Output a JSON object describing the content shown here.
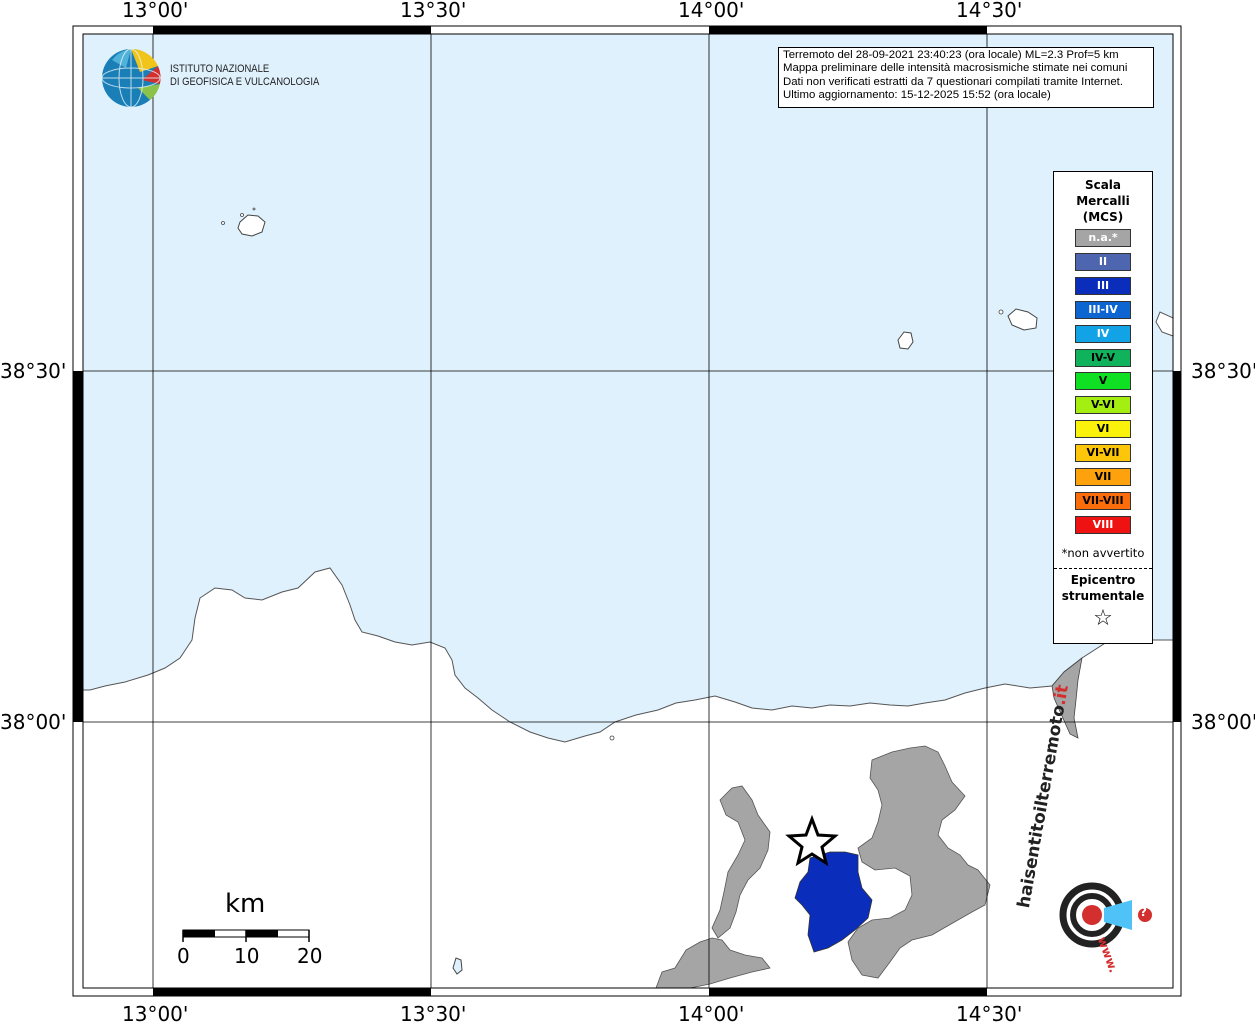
{
  "map": {
    "sea_color": "#dff1fd",
    "land_color": "#ffffff",
    "frame_color": "#000000"
  },
  "coordinates": {
    "lon_top": [
      "13°00'",
      "13°30'",
      "14°00'",
      "14°30'"
    ],
    "lon_bottom": [
      "13°00'",
      "13°30'",
      "14°00'",
      "14°30'"
    ],
    "lat_left": [
      "38°30'",
      "38°00'"
    ],
    "lat_right": [
      "38°30'",
      "38°00'"
    ]
  },
  "logo": {
    "line1": "ISTITUTO NAZIONALE",
    "line2": "DI GEOFISICA E VULCANOLOGIA"
  },
  "info": {
    "line1": "Terremoto del 28-09-2021 23:40:23 (ora locale) ML=2.3 Prof=5 km",
    "line2": "Mappa preliminare delle intensità macrosismiche stimate nei comuni",
    "line3": "Dati non verificati estratti da 7 questionari compilati tramite Internet.",
    "line4": "Ultimo aggiornamento: 15-12-2025 15:52 (ora locale)"
  },
  "legend": {
    "title1": "Scala",
    "title2": "Mercalli",
    "title3": "(MCS)",
    "items": [
      {
        "label": "n.a.*",
        "color": "#a5a5a5",
        "text_color": "#ffffff"
      },
      {
        "label": "II",
        "color": "#4e66b0",
        "text_color": "#ffffff"
      },
      {
        "label": "III",
        "color": "#0a2dbb",
        "text_color": "#ffffff"
      },
      {
        "label": "III-IV",
        "color": "#0d65d2",
        "text_color": "#ffffff"
      },
      {
        "label": "IV",
        "color": "#12a3e6",
        "text_color": "#ffffff"
      },
      {
        "label": "IV-V",
        "color": "#10b35c",
        "text_color": "#000000"
      },
      {
        "label": "V",
        "color": "#10e024",
        "text_color": "#000000"
      },
      {
        "label": "V-VI",
        "color": "#a5ee12",
        "text_color": "#000000"
      },
      {
        "label": "VI",
        "color": "#fbf20c",
        "text_color": "#000000"
      },
      {
        "label": "VI-VII",
        "color": "#fdc60b",
        "text_color": "#000000"
      },
      {
        "label": "VII",
        "color": "#fda10c",
        "text_color": "#000000"
      },
      {
        "label": "VII-VIII",
        "color": "#fb6d0b",
        "text_color": "#000000"
      },
      {
        "label": "VIII",
        "color": "#ef1212",
        "text_color": "#ffffff"
      }
    ],
    "note": "*non avvertito",
    "epicenter1": "Epicentro",
    "epicenter2": "strumentale",
    "star_symbol": "☆"
  },
  "scalebar": {
    "title": "km",
    "labels": [
      "0",
      "10",
      "20"
    ]
  },
  "intensity_areas": [
    {
      "name": "comune III",
      "intensity": "III",
      "color": "#0a2dbb"
    },
    {
      "name": "comuni n.a.",
      "intensity": "n.a.*",
      "color": "#a5a5a5"
    }
  ],
  "badge": {
    "text_main": "haisentitoilterremoto",
    "text_it": ".it",
    "text_www": "www.",
    "question": "?"
  }
}
